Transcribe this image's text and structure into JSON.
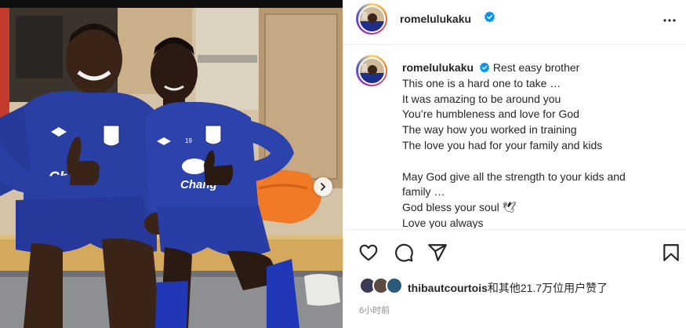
{
  "post": {
    "username": "romelulukaku",
    "verified": true,
    "more_icon": "more-horizontal-icon",
    "caption_lines": [
      "Rest easy brother",
      "This one is a hard one to take …",
      "It was amazing to be around you",
      "You’re humbleness and love for God",
      "The way how you worked in training",
      "The love you had for your family and kids",
      "",
      "May God give all the strength to your kids and family …",
      "God bless your soul 🕊",
      "Love you always"
    ],
    "actions": {
      "like_icon": "heart-icon",
      "comment_icon": "comment-icon",
      "share_icon": "send-icon",
      "save_icon": "bookmark-icon"
    },
    "likes": {
      "first_liker": "thibautcourtois",
      "others_text": "和其他21.7万位用户赞了"
    },
    "timestamp": "6小时前"
  },
  "media": {
    "jersey_sponsor": "Chang",
    "player_number": "19",
    "carousel_icon": "chevron-right-icon"
  },
  "colors": {
    "verified_blue": "#0095f6",
    "everton_blue": "#2a3fa3",
    "text": "#262626",
    "secondary_text": "#8e8e8e",
    "divider": "#efefef"
  }
}
